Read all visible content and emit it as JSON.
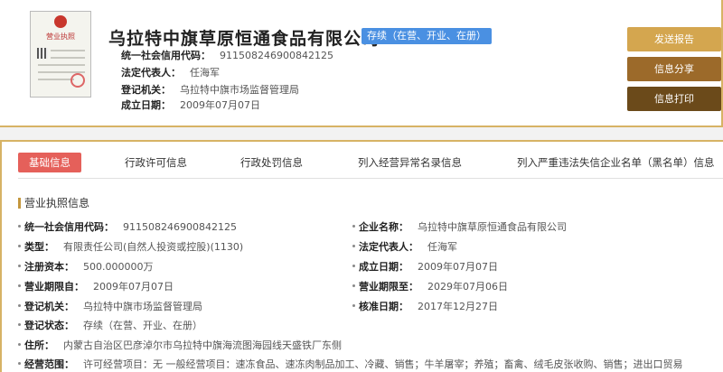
{
  "company": {
    "name": "乌拉特中旗草原恒通食品有限公司",
    "status": "存续（在营、开业、在册）",
    "license_title": "营业执照"
  },
  "summary": [
    {
      "label": "统一社会信用代码：",
      "value": "911508246900842125"
    },
    {
      "label": "法定代表人：",
      "value": "任海军"
    },
    {
      "label": "登记机关：",
      "value": "乌拉特中旗市场监督管理局"
    },
    {
      "label": "成立日期：",
      "value": "2009年07月07日"
    }
  ],
  "actions": {
    "report": "发送报告",
    "share": "信息分享",
    "print": "信息打印"
  },
  "tabs": [
    "基础信息",
    "行政许可信息",
    "行政处罚信息",
    "列入经营异常名录信息",
    "列入严重违法失信企业名单（黑名单）信息"
  ],
  "section_title": "营业执照信息",
  "fields": {
    "credit_code": {
      "label": "统一社会信用代码：",
      "value": "911508246900842125"
    },
    "name": {
      "label": "企业名称：",
      "value": "乌拉特中旗草原恒通食品有限公司"
    },
    "type": {
      "label": "类型：",
      "value": "有限责任公司(自然人投资或控股)(1130)"
    },
    "legal_rep": {
      "label": "法定代表人：",
      "value": "任海军"
    },
    "capital": {
      "label": "注册资本：",
      "value": "500.000000万"
    },
    "established": {
      "label": "成立日期：",
      "value": "2009年07月07日"
    },
    "term_from": {
      "label": "营业期限自：",
      "value": "2009年07月07日"
    },
    "term_to": {
      "label": "营业期限至：",
      "value": "2029年07月06日"
    },
    "authority": {
      "label": "登记机关：",
      "value": "乌拉特中旗市场监督管理局"
    },
    "approved": {
      "label": "核准日期：",
      "value": "2017年12月27日"
    },
    "reg_status": {
      "label": "登记状态：",
      "value": "存续（在营、开业、在册）"
    },
    "address": {
      "label": "住所：",
      "value": "内蒙古自治区巴彦淖尔市乌拉特中旗海流图海园线天盛铁厂东侧"
    },
    "scope": {
      "label": "经营范围：",
      "value": "许可经营项目：无 一般经营项目：速冻食品、速冻肉制品加工、冷藏、销售；牛羊屠宰；养殖；畜禽、绒毛皮张收购、销售；进出口贸易"
    }
  },
  "colors": {
    "gold": "#d7b365",
    "status_blue": "#4a90e2",
    "tab_active": "#e5605a"
  }
}
